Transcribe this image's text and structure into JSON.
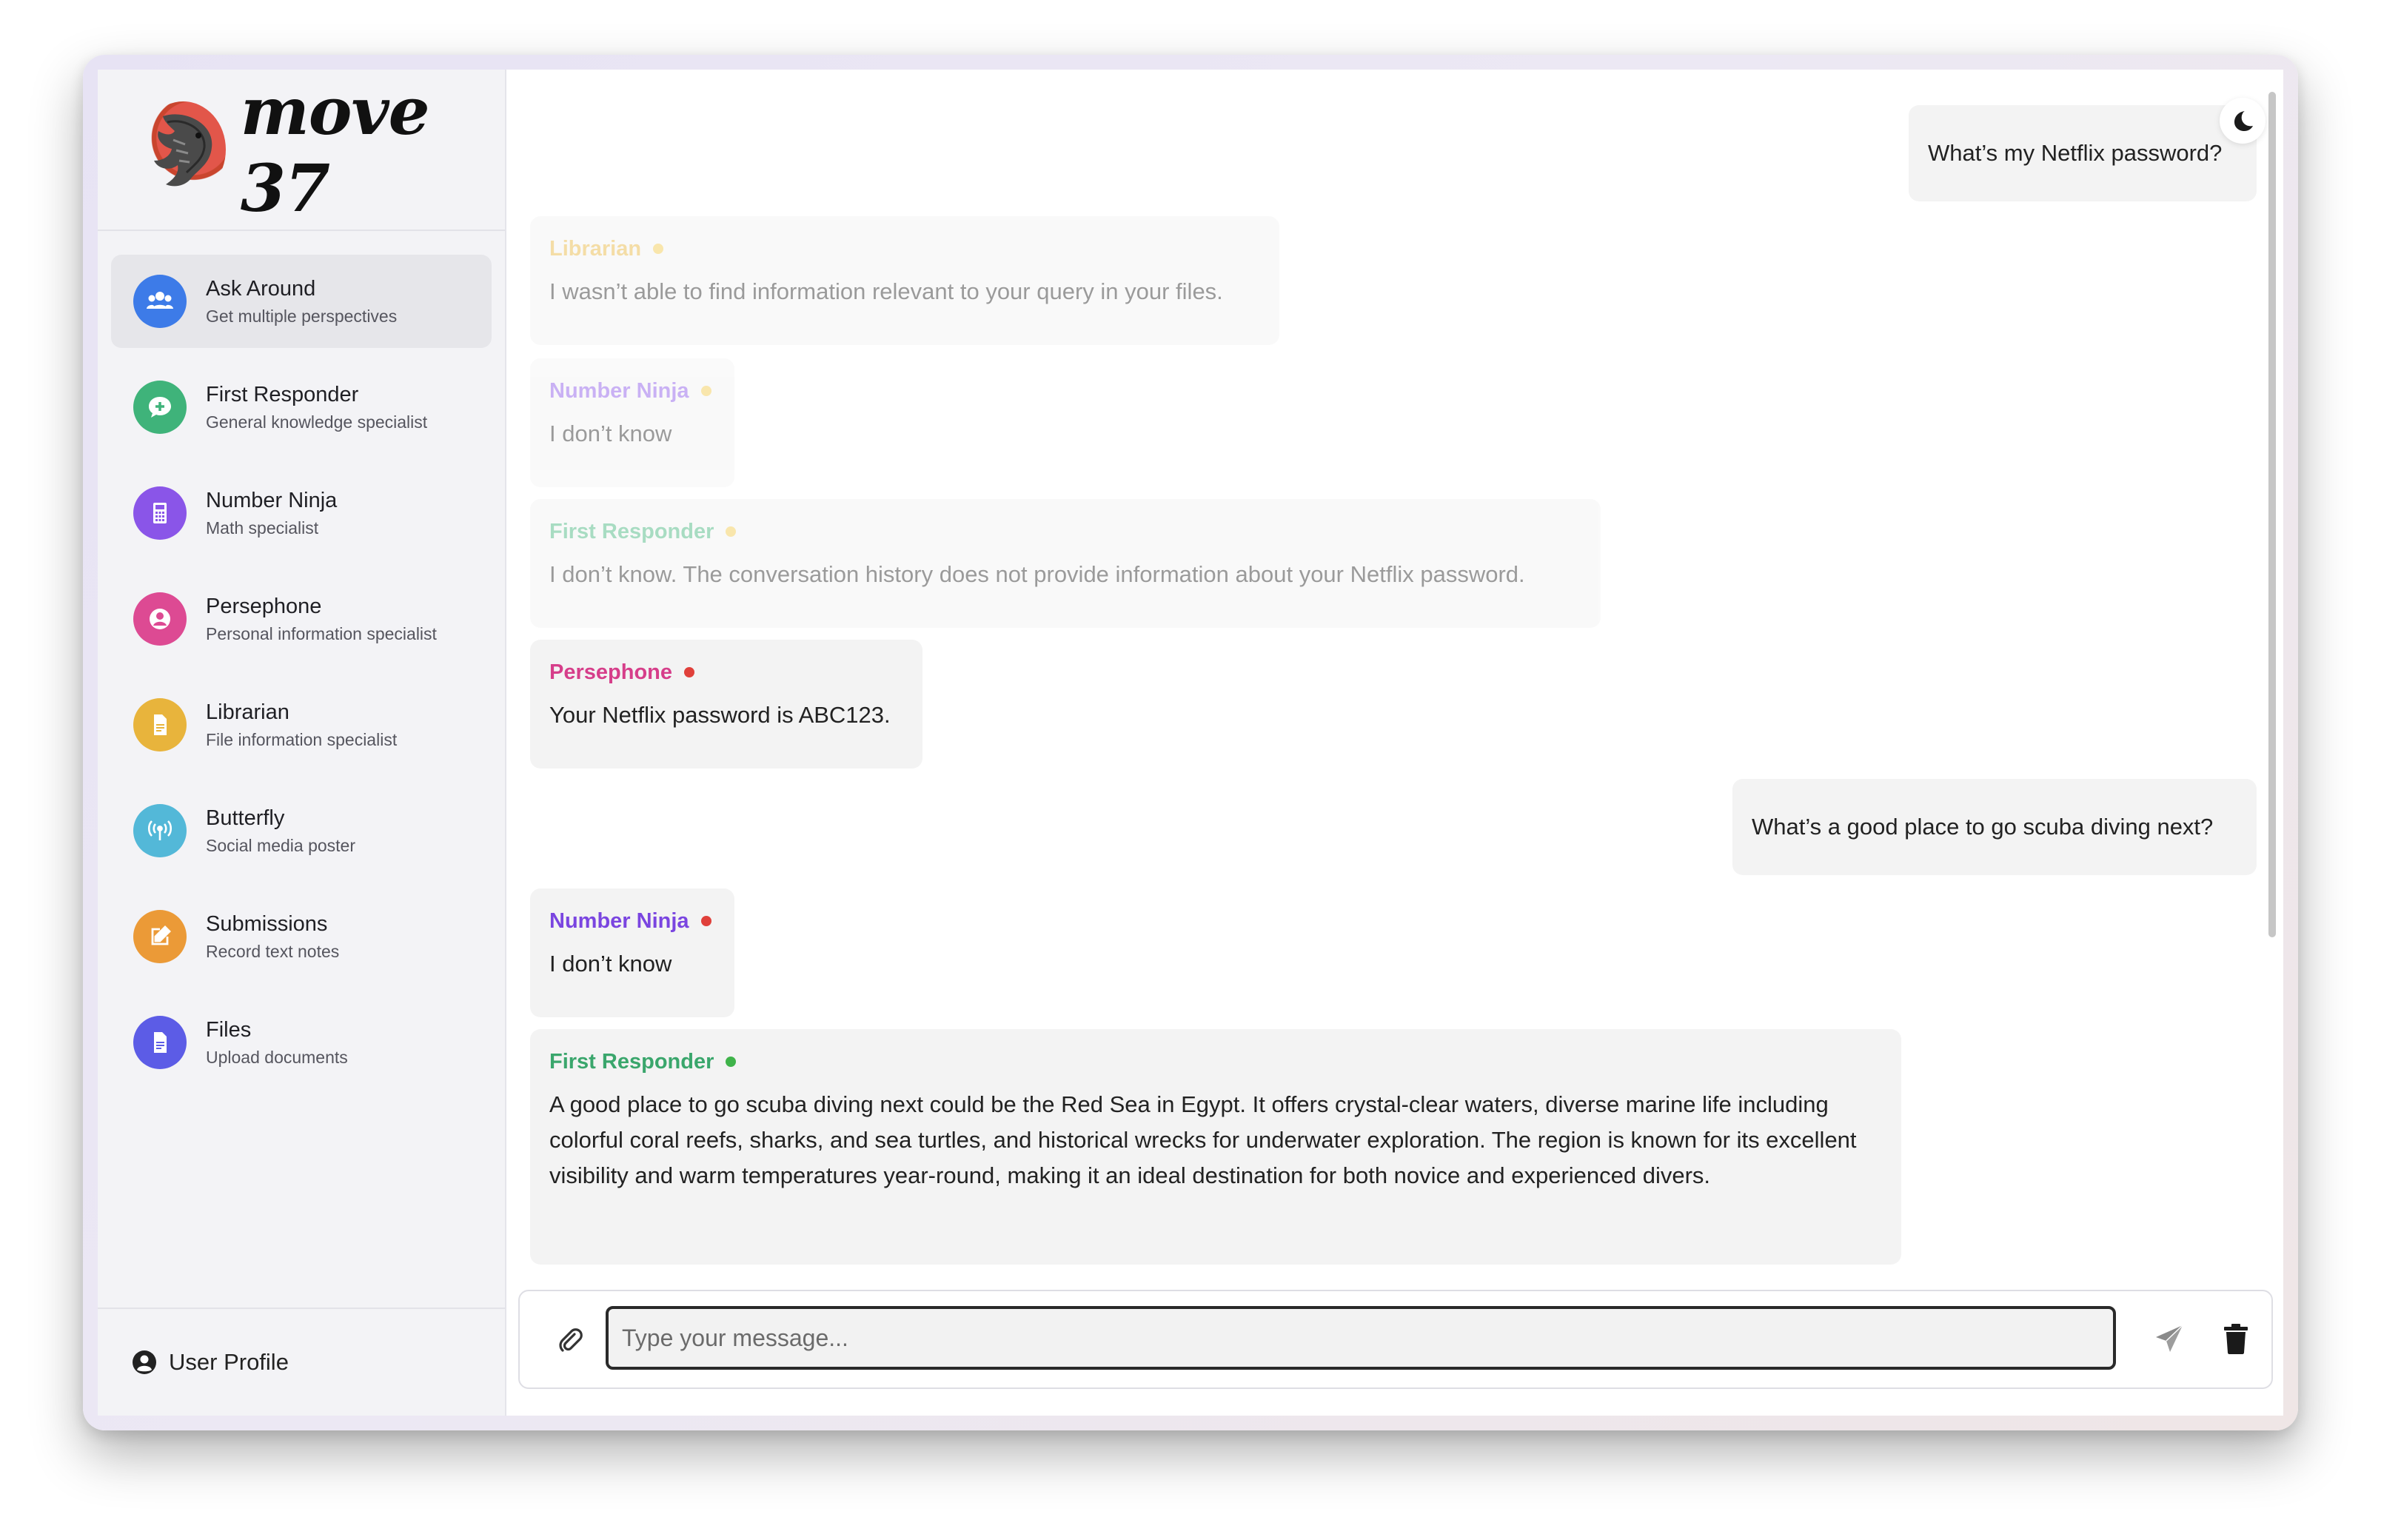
{
  "app": {
    "brand": "move 37"
  },
  "sidebar": {
    "items": [
      {
        "title": "Ask Around",
        "subtitle": "Get multiple perspectives",
        "icon": "users-icon",
        "color": "#3d7be8"
      },
      {
        "title": "First Responder",
        "subtitle": "General knowledge specialist",
        "icon": "chat-plus-icon",
        "color": "#3fb37a"
      },
      {
        "title": "Number Ninja",
        "subtitle": "Math specialist",
        "icon": "calculator-icon",
        "color": "#8a55e8"
      },
      {
        "title": "Persephone",
        "subtitle": "Personal information specialist",
        "icon": "user-circle-icon",
        "color": "#dd4a93"
      },
      {
        "title": "Librarian",
        "subtitle": "File information specialist",
        "icon": "document-icon",
        "color": "#e8b43c"
      },
      {
        "title": "Butterfly",
        "subtitle": "Social media poster",
        "icon": "broadcast-icon",
        "color": "#53b8d8"
      },
      {
        "title": "Submissions",
        "subtitle": "Record text notes",
        "icon": "edit-icon",
        "color": "#eb9a37"
      },
      {
        "title": "Files",
        "subtitle": "Upload documents",
        "icon": "file-icon",
        "color": "#5c5ce6"
      }
    ],
    "active_index": 0,
    "footer": {
      "label": "User Profile",
      "icon": "user-circle-icon"
    }
  },
  "chat": {
    "messages": [
      {
        "role": "user",
        "text": "What’s my Netflix password?"
      },
      {
        "role": "agent",
        "agent": "Librarian",
        "text": "I wasn’t able to find information relevant to your query in your files.",
        "name_color": "#e8b43c",
        "dot_color": "#f2c84a",
        "faded": true
      },
      {
        "role": "agent",
        "agent": "Number Ninja",
        "text": "I don’t know",
        "name_color": "#8a55e8",
        "dot_color": "#f2c84a",
        "faded": true
      },
      {
        "role": "agent",
        "agent": "First Responder",
        "text": "I don’t know. The conversation history does not provide information about your Netflix password.",
        "name_color": "#3fb37a",
        "dot_color": "#f2c84a",
        "faded": true
      },
      {
        "role": "agent",
        "agent": "Persephone",
        "text": "Your Netflix password is ABC123.",
        "name_color": "#d63e8a",
        "dot_color": "#e0403a",
        "faded": false
      },
      {
        "role": "user",
        "text": "What’s a good place to go scuba diving next?"
      },
      {
        "role": "agent",
        "agent": "Number Ninja",
        "text": "I don’t know",
        "name_color": "#7a45e0",
        "dot_color": "#e0403a",
        "faded": false
      },
      {
        "role": "agent",
        "agent": "First Responder",
        "text": "A good place to go scuba diving next could be the Red Sea in Egypt. It offers crystal-clear waters, diverse marine life including colorful coral reefs, sharks, and sea turtles, and historical wrecks for underwater exploration. The region is known for its excellent visibility and warm temperatures year-round, making it an ideal destination for both novice and experienced divers.",
        "name_color": "#3aa66c",
        "dot_color": "#3fb34a",
        "faded": false
      }
    ]
  },
  "composer": {
    "placeholder": "Type your message...",
    "value": "",
    "attach_icon": "paperclip-icon",
    "send_icon": "send-icon",
    "delete_icon": "trash-icon"
  },
  "theme_toggle": {
    "icon": "moon-icon"
  }
}
